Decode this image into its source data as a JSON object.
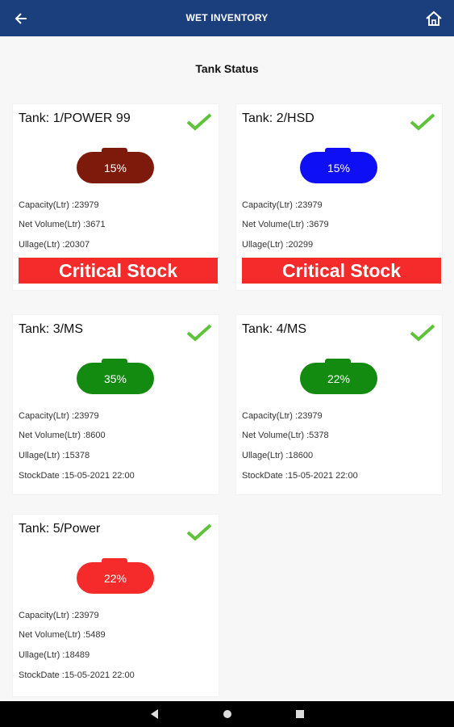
{
  "appbar": {
    "title": "WET INVENTORY",
    "back_icon": "arrow-left-icon",
    "home_icon": "home-icon"
  },
  "section_title": "Tank Status",
  "labels": {
    "capacity": "Capacity(Ltr) :",
    "net_volume": "Net Volume(Ltr) :",
    "ullage": "Ullage(Ltr) :",
    "stock_date": "StockDate :"
  },
  "tanks": [
    {
      "name": "Tank: 1/POWER 99",
      "percent": "15%",
      "color": "#7d1a0b",
      "capacity": "23979",
      "net_volume": "3671",
      "ullage": "20307",
      "status": "Critical Stock"
    },
    {
      "name": "Tank: 2/HSD",
      "percent": "15%",
      "color": "#0f0ff5",
      "capacity": "23979",
      "net_volume": "3679",
      "ullage": "20299",
      "status": "Critical Stock"
    },
    {
      "name": "Tank: 3/MS",
      "percent": "35%",
      "color": "#138b11",
      "capacity": "23979",
      "net_volume": "8600",
      "ullage": "15378",
      "stock_date": "15-05-2021 22:00"
    },
    {
      "name": "Tank: 4/MS",
      "percent": "22%",
      "color": "#138b11",
      "capacity": "23979",
      "net_volume": "5378",
      "ullage": "18600",
      "stock_date": "15-05-2021 22:00"
    },
    {
      "name": "Tank: 5/Power",
      "percent": "22%",
      "color": "#f52b2b",
      "capacity": "23979",
      "net_volume": "5489",
      "ullage": "18489",
      "stock_date": "15-05-2021 22:00"
    }
  ],
  "colors": {
    "appbar": "#1b3f7d",
    "check": "#5ec23a",
    "critical": "#f52b2b"
  },
  "navbar": {
    "back_icon": "triangle-back-icon",
    "home_icon": "circle-home-icon",
    "recents_icon": "square-recents-icon"
  }
}
